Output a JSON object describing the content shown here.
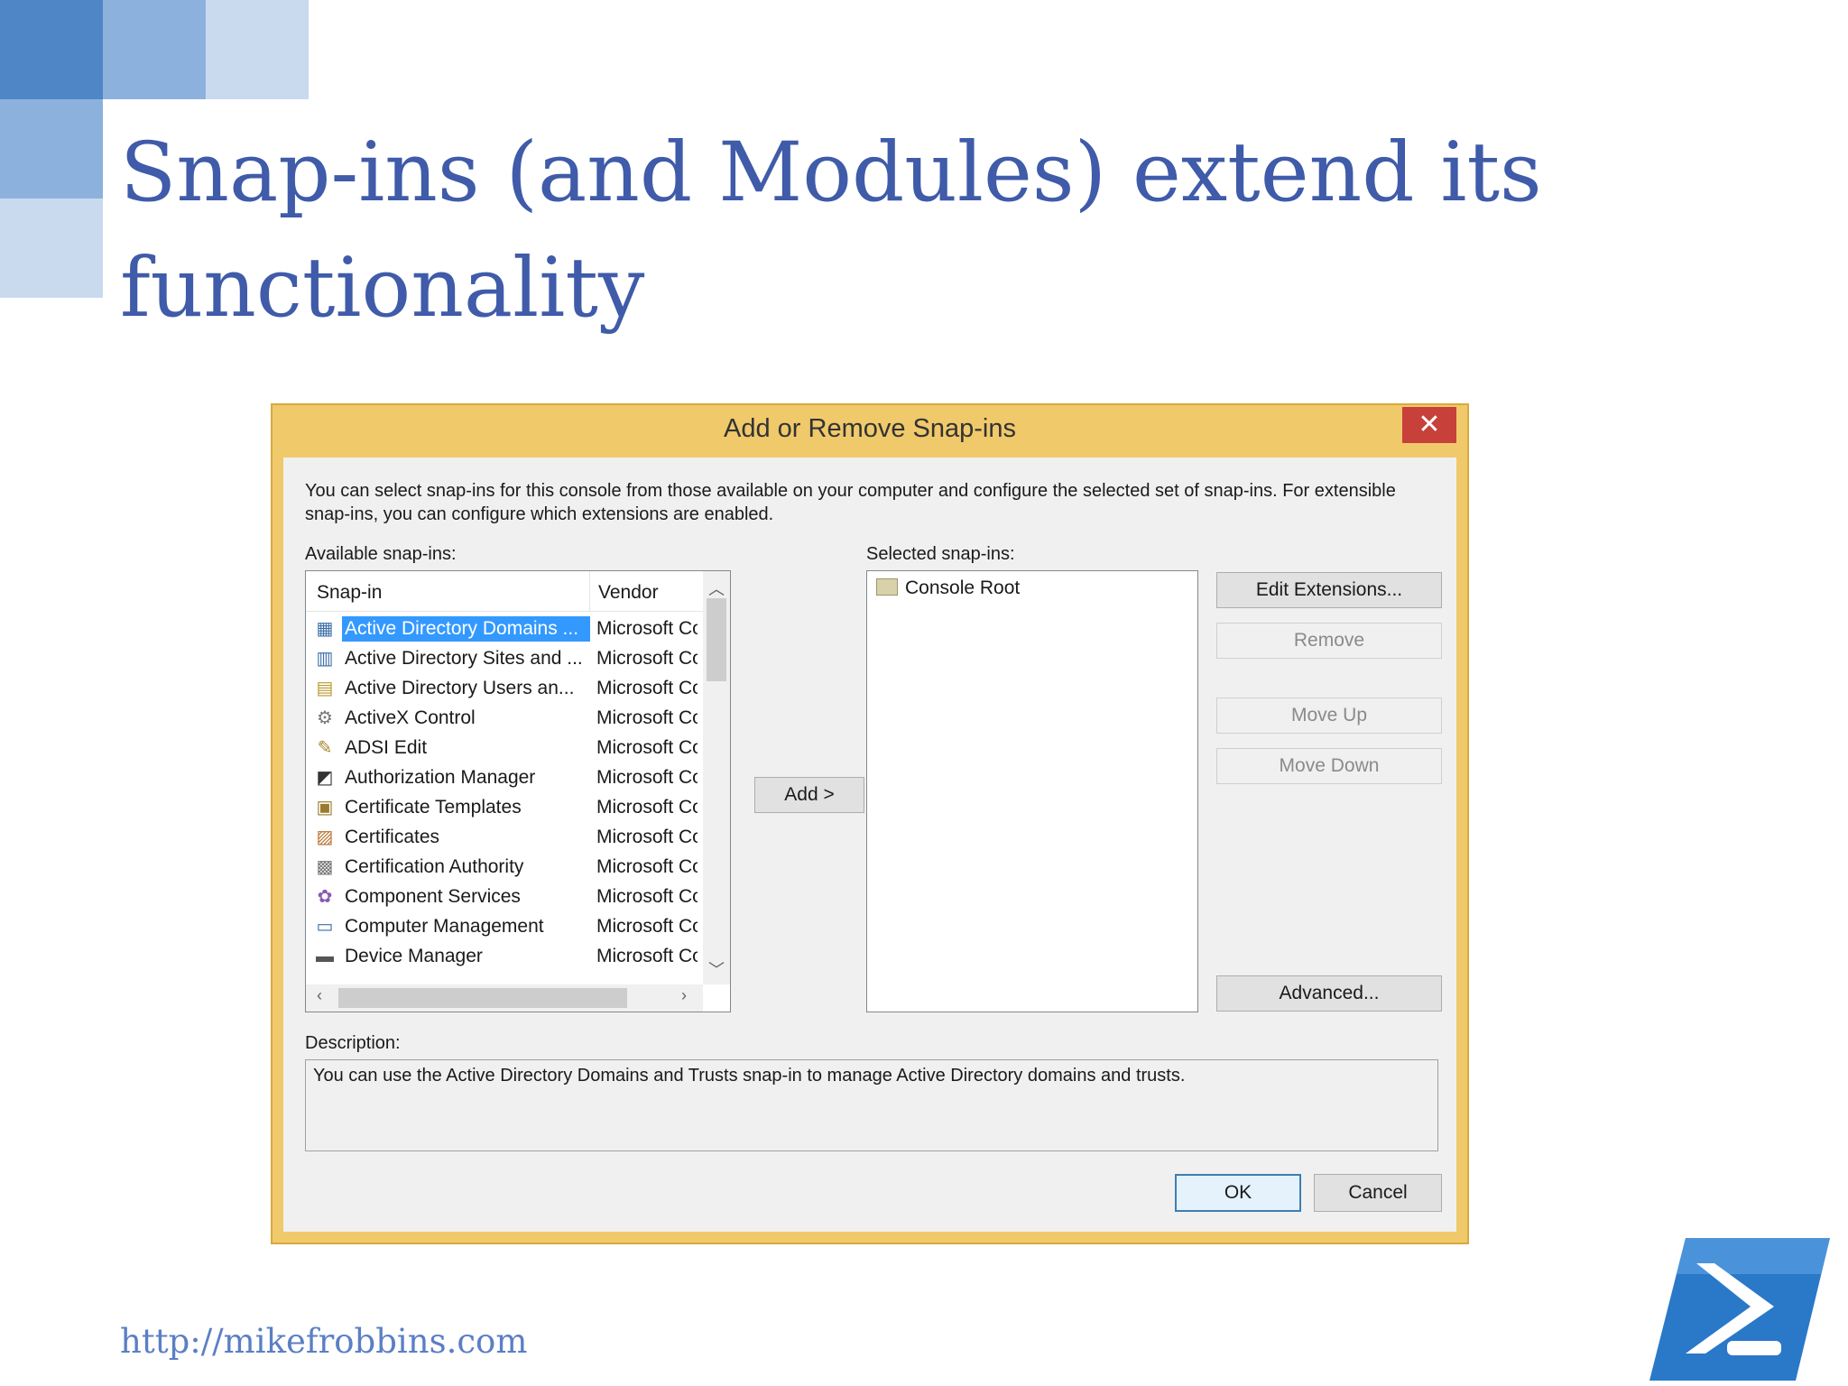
{
  "slide": {
    "title": "Snap-ins (and Modules) extend its functionality",
    "footer_url": "http://mikefrobbins.com"
  },
  "colors": {
    "title": "#3f5ba9",
    "deco_squares": [
      "#4f86c6",
      "#8db1dd",
      "#c9daef"
    ],
    "dialog_frame": "#f0c96b",
    "selection": "#3399ff"
  },
  "dialog": {
    "title": "Add or Remove Snap-ins",
    "close_icon": "close-x",
    "intro": "You can select snap-ins for this console from those available on your computer and configure the selected set of snap-ins. For extensible snap-ins, you can configure which extensions are enabled.",
    "available_label": "Available snap-ins:",
    "selected_label": "Selected snap-ins:",
    "columns": [
      "Snap-in",
      "Vendor"
    ],
    "snapins": [
      {
        "name": "Active Directory Domains ...",
        "vendor": "Microsoft Co",
        "icon": "domains-icon",
        "selected": true
      },
      {
        "name": "Active Directory Sites and ...",
        "vendor": "Microsoft Co",
        "icon": "sites-icon"
      },
      {
        "name": "Active Directory Users an...",
        "vendor": "Microsoft Co",
        "icon": "users-icon"
      },
      {
        "name": "ActiveX Control",
        "vendor": "Microsoft Co",
        "icon": "activex-icon"
      },
      {
        "name": "ADSI Edit",
        "vendor": "Microsoft Co",
        "icon": "edit-icon"
      },
      {
        "name": "Authorization Manager",
        "vendor": "Microsoft Co",
        "icon": "auth-icon"
      },
      {
        "name": "Certificate Templates",
        "vendor": "Microsoft Co",
        "icon": "cert-template-icon"
      },
      {
        "name": "Certificates",
        "vendor": "Microsoft Co",
        "icon": "certificate-icon"
      },
      {
        "name": "Certification Authority",
        "vendor": "Microsoft Co",
        "icon": "ca-icon"
      },
      {
        "name": "Component Services",
        "vendor": "Microsoft Co",
        "icon": "component-icon"
      },
      {
        "name": "Computer Management",
        "vendor": "Microsoft Co",
        "icon": "computer-icon"
      },
      {
        "name": "Device Manager",
        "vendor": "Microsoft Co",
        "icon": "device-icon"
      }
    ],
    "add_button": "Add >",
    "selected_item": "Console Root",
    "buttons": {
      "edit_extensions": "Edit Extensions...",
      "remove": "Remove",
      "move_up": "Move Up",
      "move_down": "Move Down",
      "advanced": "Advanced..."
    },
    "description_label": "Description:",
    "description": "You can use the Active Directory Domains and Trusts snap-in to manage Active Directory domains and trusts.",
    "ok": "OK",
    "cancel": "Cancel"
  }
}
